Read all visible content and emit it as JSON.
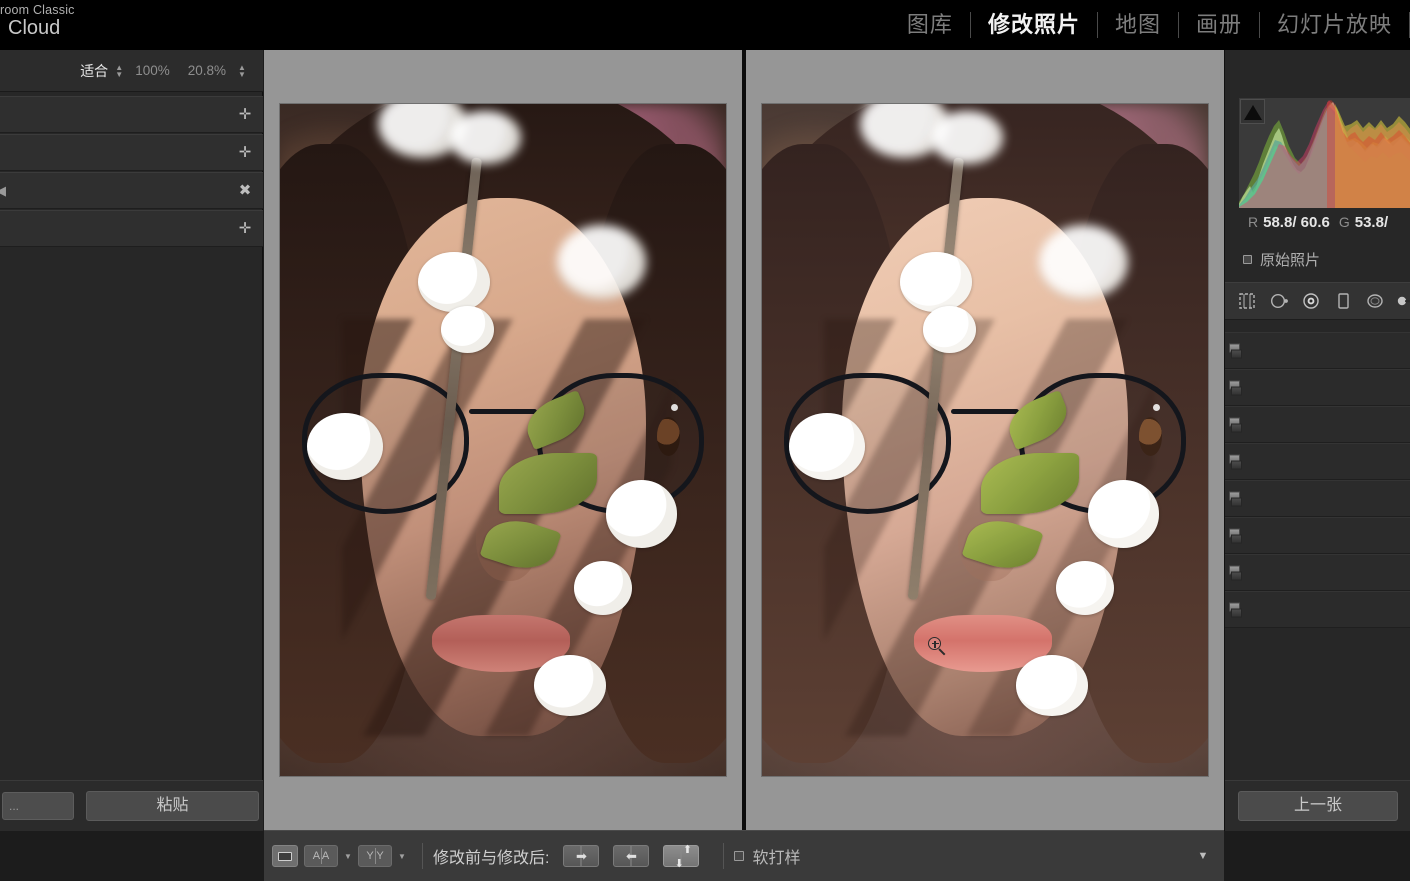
{
  "app": {
    "brand_line1": "room Classic",
    "brand_line2": "Cloud"
  },
  "module_nav": {
    "items": [
      {
        "label": "图库",
        "active": false
      },
      {
        "label": "修改照片",
        "active": true
      },
      {
        "label": "地图",
        "active": false
      },
      {
        "label": "画册",
        "active": false
      },
      {
        "label": "幻灯片放映",
        "active": false
      }
    ]
  },
  "left_panel": {
    "zoom_toolbar": {
      "fit_label": "适合",
      "value_100": "100%",
      "value_custom": "20.8%"
    },
    "rows": [
      {
        "name": "preset-row-1",
        "icon": "plus-icon",
        "glyph": "✛"
      },
      {
        "name": "preset-row-2",
        "icon": "plus-icon",
        "glyph": "✛"
      },
      {
        "name": "history-row",
        "icon": "close-icon",
        "glyph": "✖"
      },
      {
        "name": "collections-row",
        "icon": "plus-icon",
        "glyph": "✛"
      }
    ],
    "bottom": {
      "dots_label": "...",
      "paste_label": "粘贴"
    }
  },
  "toolbar": {
    "view_loupe": "loupe-view",
    "view_before_after": "A A",
    "view_split": "Y Y",
    "before_after_label": "修改前与修改后:",
    "copy_right_glyph": "➡",
    "copy_left_glyph": "⬅",
    "swap_up_glyph": "⬆",
    "swap_down_glyph": "⬇",
    "soft_proof_label": "软打样",
    "dropdown_glyph": "▼"
  },
  "right_panel": {
    "histogram": {
      "title": "histogram",
      "shadow_clip_indicator": "shadow-clipping-triangle"
    },
    "rgb_readout": {
      "r_label": "R",
      "r_value": "58.8/ 60.6",
      "g_label": "G",
      "g_value": "53.8/"
    },
    "original_photo_label": "原始照片",
    "tools": [
      {
        "name": "crop-tool-icon"
      },
      {
        "name": "spot-removal-tool-icon"
      },
      {
        "name": "red-eye-tool-icon"
      },
      {
        "name": "mask-tool-icon"
      },
      {
        "name": "radial-filter-tool-icon"
      },
      {
        "name": "adjustment-brush-tool-icon"
      }
    ],
    "slider_rows": [
      {
        "name": "panel-row-basic"
      },
      {
        "name": "panel-row-tone-curve"
      },
      {
        "name": "panel-row-hsl"
      },
      {
        "name": "panel-row-color-grading"
      },
      {
        "name": "panel-row-detail"
      },
      {
        "name": "panel-row-lens-corrections"
      },
      {
        "name": "panel-row-transform"
      },
      {
        "name": "panel-row-effects"
      }
    ],
    "bottom": {
      "prev_label": "上一张"
    }
  },
  "canvas": {
    "before_pane": "before-image",
    "after_pane": "after-image",
    "cursor": "zoom-in-magnifier-cursor"
  },
  "colors": {
    "window_bg": "#1c1c1c",
    "panel_bg": "#272727",
    "canvas_bg": "#969696",
    "toolbar_bg": "#3a3a3a",
    "accent_text": "#f2f2f2"
  }
}
